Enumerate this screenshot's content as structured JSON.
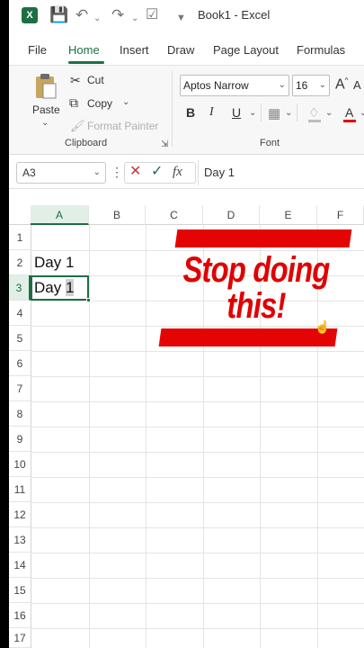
{
  "titlebar": {
    "app_logo": "X",
    "title": "Book1 - Excel",
    "icons": [
      "excel-logo-icon",
      "save-icon",
      "undo-icon",
      "redo-icon",
      "checkbox-icon",
      "customize-qat-icon"
    ]
  },
  "tabs": [
    "File",
    "Home",
    "Insert",
    "Draw",
    "Page Layout",
    "Formulas"
  ],
  "ribbon": {
    "clipboard": {
      "paste_label": "Paste",
      "cut_label": "Cut",
      "copy_label": "Copy",
      "format_painter_label": "Format Painter",
      "group_label": "Clipboard"
    },
    "font": {
      "font_name": "Aptos Narrow",
      "font_size": "16",
      "bold": "B",
      "italic": "I",
      "underline": "U",
      "font_color_glyph": "A",
      "group_label": "Font"
    },
    "colors": {
      "excel_green": "#1d6f42",
      "font_color_bar": "#e00000"
    }
  },
  "formula_bar": {
    "name_box": "A3",
    "fx_label": "fx",
    "value": "Day 1"
  },
  "grid": {
    "columns": [
      "A",
      "B",
      "C",
      "D",
      "E",
      "F"
    ],
    "rows": [
      "1",
      "2",
      "3",
      "4",
      "5",
      "6",
      "7",
      "8",
      "9",
      "10",
      "11",
      "12",
      "13",
      "14",
      "15",
      "16",
      "17"
    ],
    "selected_cell": "A3",
    "cells": {
      "A2": "Day 1",
      "A3_prefix": "Day ",
      "A3_suffix": "1"
    }
  },
  "overlay": {
    "line1": "Stop doing",
    "line2": "this!",
    "color": "#e40404"
  }
}
